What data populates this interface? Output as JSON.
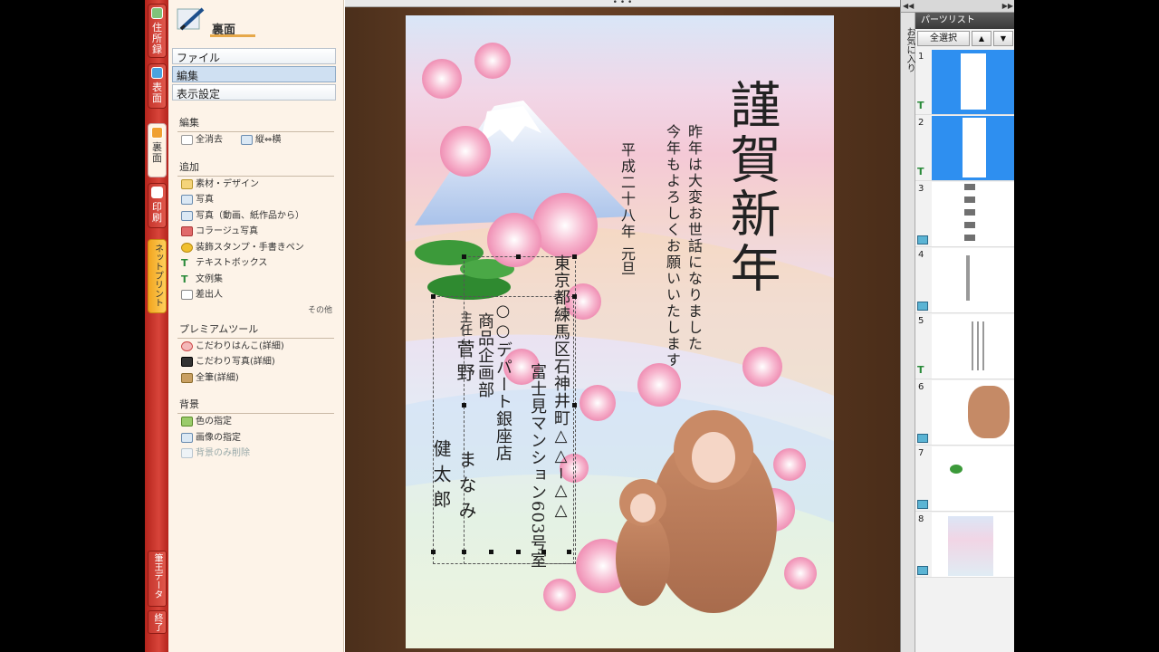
{
  "rail": {
    "tabs": [
      {
        "label": "住所録",
        "active": false
      },
      {
        "label": "表面",
        "active": false
      },
      {
        "label": "裏面",
        "active": true
      },
      {
        "label": "印刷",
        "active": false
      },
      {
        "label": "ネットプリント",
        "active": false
      }
    ],
    "bottom": [
      "筆王データ",
      "終了"
    ]
  },
  "panel": {
    "title": "裏面",
    "menus": [
      "ファイル",
      "編集",
      "表示設定"
    ],
    "edit": {
      "title": "編集",
      "items": [
        {
          "label": "全消去",
          "icon": "page-icon"
        },
        {
          "label": "縦⇔横",
          "icon": "rotate-icon"
        }
      ]
    },
    "add": {
      "title": "追加",
      "items": [
        "素材・デザイン",
        "写真",
        "写真（動画、紙作品から）",
        "コラージュ写真",
        "装飾スタンプ・手書きペン",
        "テキストボックス",
        "文例集",
        "差出人"
      ],
      "more": "その他"
    },
    "premium": {
      "title": "プレミアムツール",
      "items": [
        "こだわりはんこ(詳細)",
        "こだわり写真(詳細)",
        "全筆(詳細)"
      ]
    },
    "background": {
      "title": "背景",
      "items": [
        {
          "label": "色の指定",
          "disabled": false
        },
        {
          "label": "画像の指定",
          "disabled": false
        },
        {
          "label": "背景のみ削除",
          "disabled": true
        }
      ]
    }
  },
  "canvas": {
    "grip": "• • •",
    "card": {
      "greeting": "謹賀新年",
      "message": [
        "昨年は大変お世話になりました",
        "今年もよろしくお願いいたします"
      ],
      "date": "平成二十八年",
      "date_suffix": "元旦",
      "sender": {
        "address": "東京都練馬区石神井町△△−△△",
        "building": "富士見マンション603号室",
        "company": "○○デパート銀座店",
        "department": "商品企画部",
        "note": "主任",
        "surname": "菅野",
        "given1": "健太郎",
        "given2": "まなみ"
      }
    }
  },
  "parts": {
    "header": "パーツリスト",
    "fav_tab": "お気に入り",
    "select_all": "全選択",
    "up": "▲",
    "down": "▼",
    "collapse": "◀◀",
    "expand": "▶▶",
    "rows": [
      {
        "num": "1",
        "kind": "text",
        "selected": true
      },
      {
        "num": "2",
        "kind": "text",
        "selected": true
      },
      {
        "num": "3",
        "kind": "image",
        "selected": false
      },
      {
        "num": "4",
        "kind": "image",
        "selected": false
      },
      {
        "num": "5",
        "kind": "text",
        "selected": false
      },
      {
        "num": "6",
        "kind": "image",
        "selected": false
      },
      {
        "num": "7",
        "kind": "image",
        "selected": false
      },
      {
        "num": "8",
        "kind": "image",
        "selected": false
      }
    ]
  },
  "colors": {
    "rail": "#d0392f",
    "panel_bg": "#fdf3e8",
    "selected_part": "#2e8ff0",
    "canvas_bg": "#5c3921"
  }
}
